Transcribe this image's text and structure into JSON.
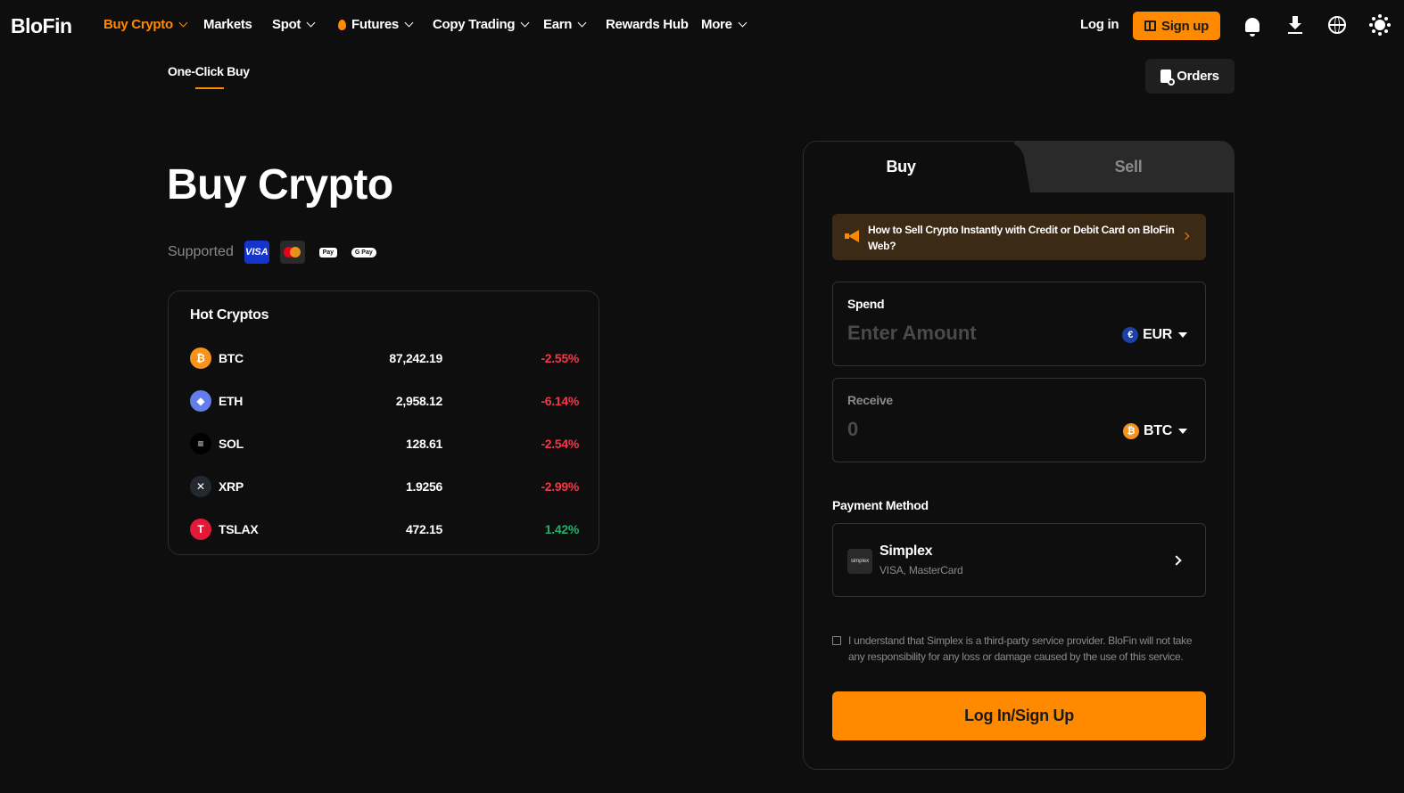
{
  "nav": {
    "logo": "BloFin",
    "items": [
      {
        "label": "Buy Crypto",
        "active": true,
        "dropdown": true
      },
      {
        "label": "Markets",
        "dropdown": false
      },
      {
        "label": "Spot",
        "dropdown": true
      },
      {
        "label": "Futures",
        "dropdown": true,
        "icon": "flame-icon"
      },
      {
        "label": "Copy Trading",
        "dropdown": true
      },
      {
        "label": "Earn",
        "dropdown": true
      },
      {
        "label": "Rewards Hub",
        "dropdown": false
      },
      {
        "label": "More",
        "dropdown": true
      }
    ],
    "login": "Log in",
    "signup": "Sign up",
    "icons": [
      "bell-icon",
      "download-icon",
      "globe-icon",
      "theme-sun-icon"
    ]
  },
  "subnav": {
    "tab": "One-Click Buy",
    "orders": "Orders"
  },
  "hero": {
    "title": "Buy Crypto",
    "supported_label": "Supported",
    "payment_icons": [
      "visa-icon",
      "mastercard-icon",
      "apple-pay-icon",
      "google-pay-icon"
    ],
    "visa_text": "VISA",
    "apple_pay_text": "Pay",
    "google_pay_text": "G Pay"
  },
  "hot": {
    "title": "Hot Cryptos",
    "rows": [
      {
        "symbol": "BTC",
        "price": "87,242.19",
        "change": "-2.55%",
        "positive": false,
        "icon_color": "#f7931a",
        "glyph": "₿"
      },
      {
        "symbol": "ETH",
        "price": "2,958.12",
        "change": "-6.14%",
        "positive": false,
        "icon_color": "#627eea",
        "glyph": "◆"
      },
      {
        "symbol": "SOL",
        "price": "128.61",
        "change": "-2.54%",
        "positive": false,
        "icon_color": "#000000",
        "glyph": "≡"
      },
      {
        "symbol": "XRP",
        "price": "1.9256",
        "change": "-2.99%",
        "positive": false,
        "icon_color": "#23292f",
        "glyph": "✕"
      },
      {
        "symbol": "TSLAX",
        "price": "472.15",
        "change": "1.42%",
        "positive": true,
        "icon_color": "#e31937",
        "glyph": "T"
      }
    ]
  },
  "trade": {
    "tab_buy": "Buy",
    "tab_sell": "Sell",
    "banner": "How to Sell Crypto Instantly with Credit or Debit Card on BloFin Web?",
    "spend_label": "Spend",
    "spend_placeholder": "Enter Amount",
    "spend_currency": "EUR",
    "spend_currency_glyph": "€",
    "receive_label": "Receive",
    "receive_value": "0",
    "receive_currency": "BTC",
    "receive_currency_glyph": "₿",
    "payment_label": "Payment Method",
    "provider_name": "Simplex",
    "provider_logo": "simplex",
    "provider_cards": "VISA, MasterCard",
    "disclaimer": "I understand that Simplex is a third-party service provider. BloFin will not take any responsibility for any loss or damage caused by the use of this service.",
    "cta": "Log In/Sign Up"
  },
  "colors": {
    "accent": "#ff8a00",
    "negative": "#f0384a",
    "positive": "#20b26c",
    "background": "#0e0e0e"
  }
}
